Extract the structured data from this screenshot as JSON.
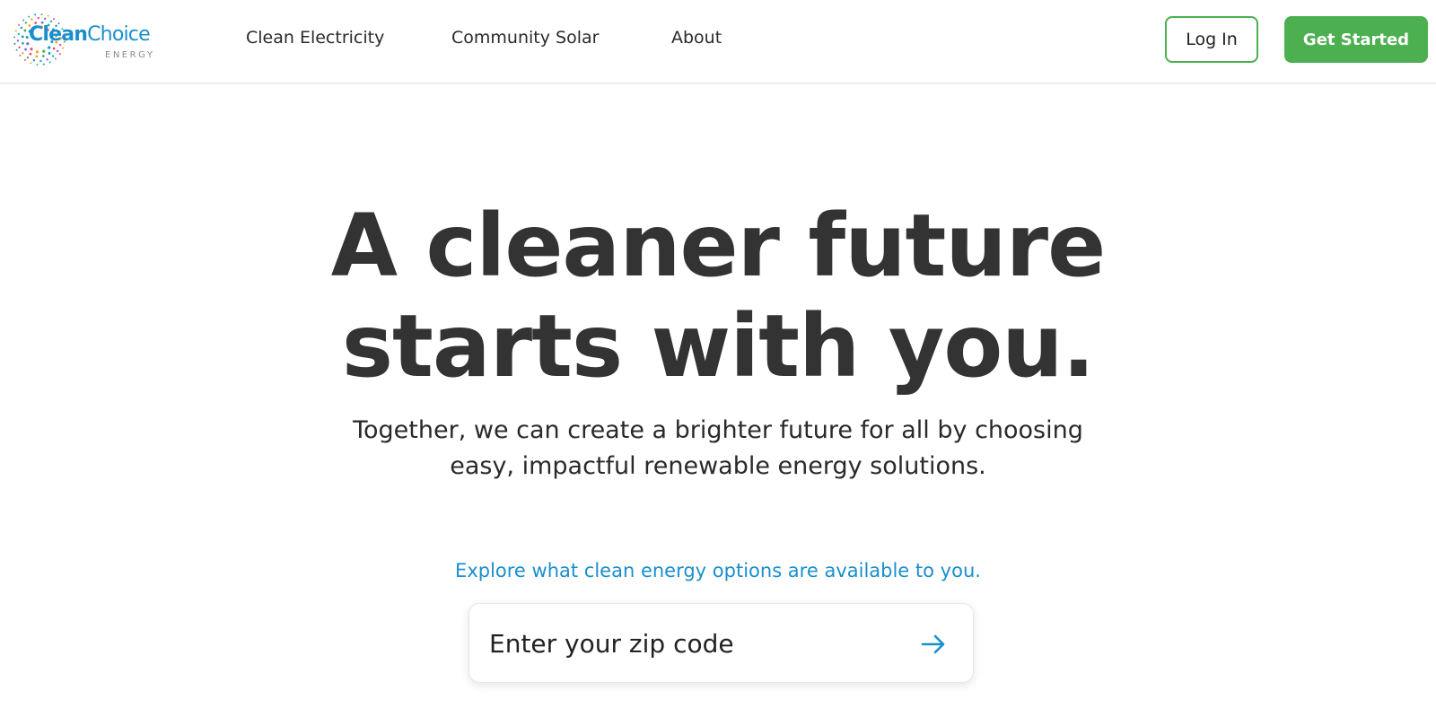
{
  "header": {
    "logo": {
      "wordmark_bold": "Clean",
      "wordmark_regular": "Choice",
      "sub": "ENERGY",
      "icon": "sunburst-dots-icon"
    },
    "nav": [
      {
        "label": "Clean Electricity"
      },
      {
        "label": "Community Solar"
      },
      {
        "label": "About"
      }
    ],
    "login_label": "Log In",
    "get_started_label": "Get Started"
  },
  "hero": {
    "title_line1": "A cleaner future",
    "title_line2": "starts with you.",
    "subtitle_line1": "Together, we can create a brighter future for all by choosing",
    "subtitle_line2": "easy, impactful renewable energy solutions.",
    "explore_text": "Explore what clean energy options are available to you.",
    "zip_placeholder": "Enter your zip code",
    "submit_icon": "arrow-right-icon"
  },
  "colors": {
    "brand_blue": "#1a8fcc",
    "brand_green": "#4caf50",
    "heading_text": "#333333"
  }
}
